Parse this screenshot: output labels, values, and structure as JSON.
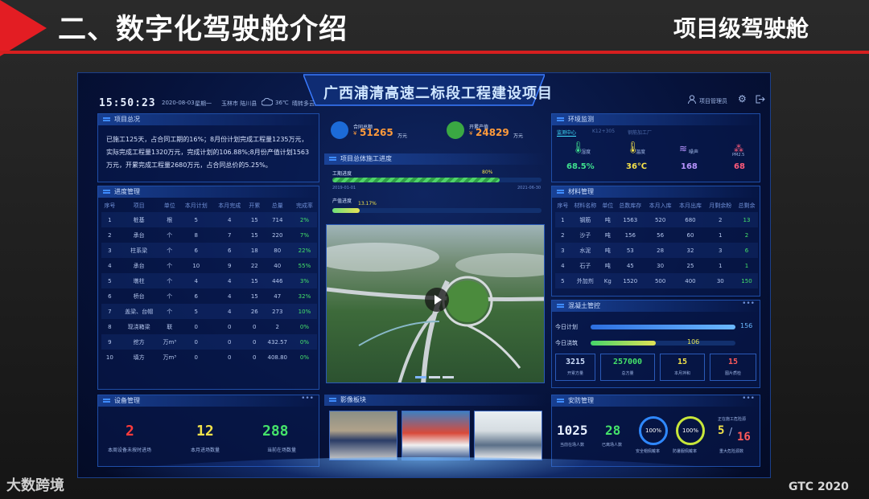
{
  "slide": {
    "title": "二、数字化驾驶舱介绍",
    "subtitle": "项目级驾驶舱",
    "footer_logo": "大数跨境",
    "footer_right": "GTC 2020"
  },
  "dashboard": {
    "title": "广西浦清高速二标段工程建设项目",
    "clock": "15:50:23",
    "date": "2020-08-03",
    "weekday": "星期一",
    "location": "玉林市 陆川县",
    "temperature": "36℃",
    "weather": "晴转多云",
    "user_label": "项目管理员"
  },
  "overview": {
    "header": "项目总况",
    "text": "已施工125天，占合同工期的16%；8月份计划完成工程量1235万元，实际完成工程量1320万元，完成计划的106.88%;8月份产值计划1563万元，开累完成工程量2680万元，占合同总价的5.25%。"
  },
  "progress_mgmt": {
    "header": "进度管理",
    "columns": [
      "序号",
      "项目",
      "单位",
      "本月计划",
      "本月完成",
      "开累",
      "总量",
      "完成率"
    ],
    "rows": [
      [
        "1",
        "桩基",
        "根",
        "5",
        "4",
        "15",
        "714",
        "2%"
      ],
      [
        "2",
        "承台",
        "个",
        "8",
        "7",
        "15",
        "220",
        "7%"
      ],
      [
        "3",
        "柱系梁",
        "个",
        "6",
        "6",
        "18",
        "80",
        "22%"
      ],
      [
        "4",
        "承台",
        "个",
        "10",
        "9",
        "22",
        "40",
        "55%"
      ],
      [
        "5",
        "墩柱",
        "个",
        "4",
        "4",
        "15",
        "446",
        "3%"
      ],
      [
        "6",
        "桥台",
        "个",
        "6",
        "4",
        "15",
        "47",
        "32%"
      ],
      [
        "7",
        "盖梁、台帽",
        "个",
        "5",
        "4",
        "26",
        "273",
        "10%"
      ],
      [
        "8",
        "现浇箱梁",
        "联",
        "0",
        "0",
        "0",
        "2",
        "0%"
      ],
      [
        "9",
        "挖方",
        "万m³",
        "0",
        "0",
        "0",
        "432.57",
        "0%"
      ],
      [
        "10",
        "填方",
        "万m³",
        "0",
        "0",
        "0",
        "408.80",
        "0%"
      ]
    ]
  },
  "kpi": {
    "contract_label": "合同总额",
    "contract_value": "51265",
    "contract_unit": "万元",
    "output_label": "开累产值",
    "output_value": "24829",
    "output_unit": "万元"
  },
  "construction_progress": {
    "header": "项目总体施工进度",
    "schedule_label": "工期进度",
    "schedule_percent": "80%",
    "schedule_fill": 0.8,
    "start_date": "2019-01-01",
    "end_date": "2021-06-30",
    "output_label": "产值进度",
    "output_percent": "13.17%",
    "output_fill": 0.1317
  },
  "env": {
    "header": "环境监测",
    "tabs": [
      "监测中心",
      "K12+305",
      "钢筋加工厂"
    ],
    "items": [
      {
        "label": "湿度",
        "value": "68.5%",
        "color": "#3fe08f"
      },
      {
        "label": "温度",
        "value": "36℃",
        "color": "#f5e14a"
      },
      {
        "label": "噪声",
        "value": "168",
        "color": "#b894ff"
      },
      {
        "label": "PM2.5",
        "value": "68",
        "color": "#ff5a7a"
      }
    ]
  },
  "materials": {
    "header": "材料管理",
    "columns": [
      "序号",
      "材料名称",
      "单位",
      "总数库存",
      "本月入库",
      "本月出库",
      "月剩余粉",
      "总剩余"
    ],
    "rows": [
      [
        "1",
        "钢筋",
        "吨",
        "1563",
        "520",
        "680",
        "2",
        "13"
      ],
      [
        "2",
        "沙子",
        "吨",
        "156",
        "56",
        "60",
        "1",
        "2"
      ],
      [
        "3",
        "水泥",
        "吨",
        "53",
        "28",
        "32",
        "3",
        "6"
      ],
      [
        "4",
        "石子",
        "吨",
        "45",
        "30",
        "25",
        "1",
        "1"
      ],
      [
        "5",
        "外加剂",
        "Kg",
        "1520",
        "500",
        "400",
        "30",
        "150"
      ]
    ]
  },
  "concrete": {
    "header": "混凝土管控",
    "plan_label": "今日计划",
    "plan_value": "156",
    "pour_label": "今日浇筑",
    "pour_value": "106",
    "stats": [
      {
        "value": "3215",
        "label": "开累方量"
      },
      {
        "value": "257000",
        "label": "总方量"
      },
      {
        "value": "15",
        "label": "本月拌和"
      },
      {
        "value": "15",
        "label": "图片质检"
      }
    ]
  },
  "equipment": {
    "header": "设备管理",
    "stats": [
      {
        "value": "2",
        "label": "本周设备未按时进场",
        "color": "#ff3b3b"
      },
      {
        "value": "12",
        "label": "本月进场数量",
        "color": "#f2e24a"
      },
      {
        "value": "288",
        "label": "当前在场数量",
        "color": "#45e36a"
      }
    ]
  },
  "images": {
    "header": "影像板块"
  },
  "safety": {
    "header": "安防管理",
    "onsite_value": "1025",
    "onsite_label": "当前在场人数",
    "exit_value": "28",
    "exit_label": "已离场人数",
    "ring1_value": "100%",
    "ring1_label": "安全帽佩戴率",
    "ring2_value": "100%",
    "ring2_label": "防暑服佩戴率",
    "danger_title": "正在施工危险源",
    "danger_current": "5",
    "danger_total": "16",
    "danger_label": "重大危险源数"
  }
}
